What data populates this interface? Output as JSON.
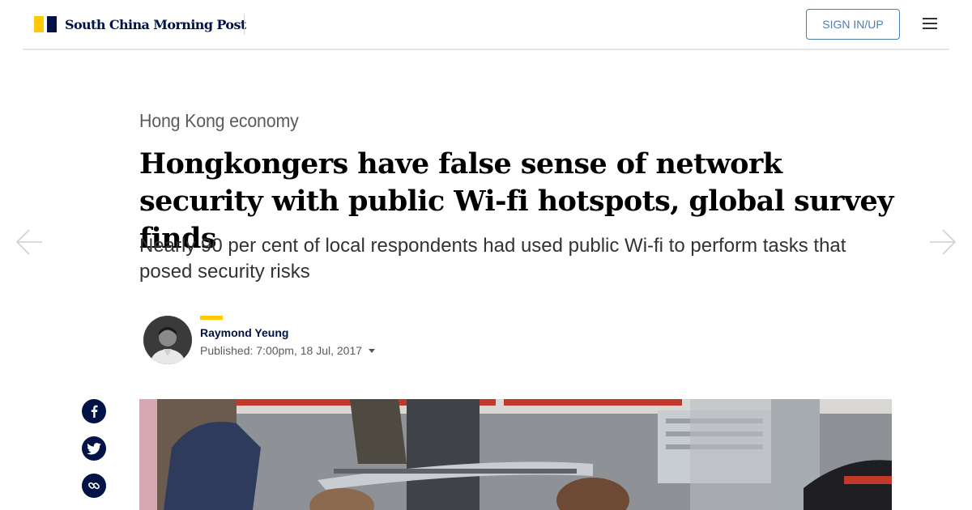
{
  "brand": {
    "name": "South China Morning Post",
    "yellow": "#ffca05",
    "navy": "#001246"
  },
  "header": {
    "signin_label": "SIGN IN/UP",
    "menu_icon": "hamburger-menu-icon"
  },
  "nav": {
    "prev_icon": "arrow-left-icon",
    "next_icon": "arrow-right-icon"
  },
  "article": {
    "section": "Hong Kong economy",
    "headline": "Hongkongers have false sense of network security with public Wi-fi hotspots, global survey finds",
    "subheadline": "Nearly 90 per cent of local respondents had used public Wi-fi to perform tasks that posed security risks",
    "author": {
      "name": "Raymond Yeung",
      "published": "Published: 7:00pm, 18 Jul, 2017"
    }
  },
  "share": {
    "icons": [
      "facebook-icon",
      "twitter-icon",
      "link-icon"
    ]
  }
}
